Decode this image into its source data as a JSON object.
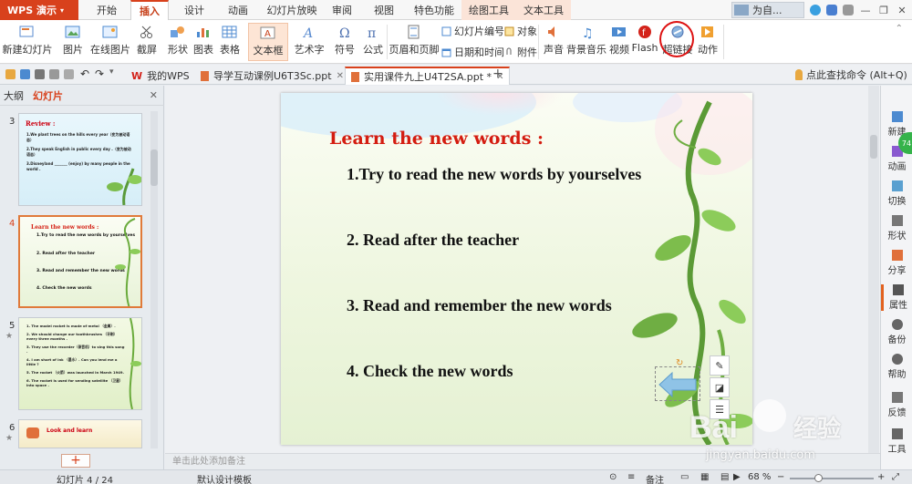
{
  "app": {
    "name": "WPS 演示"
  },
  "menu_tabs": [
    {
      "label": "开始"
    },
    {
      "label": "插入"
    },
    {
      "label": "设计"
    },
    {
      "label": "动画"
    },
    {
      "label": "幻灯片放映"
    },
    {
      "label": "审阅"
    },
    {
      "label": "视图"
    },
    {
      "label": "特色功能"
    },
    {
      "label": "绘图工具"
    },
    {
      "label": "文本工具"
    }
  ],
  "active_tab": "插入",
  "user": {
    "name": "为自..."
  },
  "ribbon": {
    "new_slide": "新建幻灯片",
    "picture": "图片",
    "online_picture": "在线图片",
    "screenshot": "截屏",
    "shape": "形状",
    "chart": "图表",
    "table": "表格",
    "textbox": "文本框",
    "art_text": "艺术字",
    "symbol": "符号",
    "formula": "公式",
    "header_footer": "页眉和页脚",
    "slide_number": "幻灯片编号",
    "object": "对象",
    "date_time": "日期和时间",
    "attachment": "附件",
    "sound": "声音",
    "bg_music": "背景音乐",
    "video": "视频",
    "flash": "Flash",
    "hyperlink": "超链接",
    "action": "动作"
  },
  "doc_tabs": [
    {
      "label": "我的WPS",
      "active": false
    },
    {
      "label": "导学互动课例U6T3Sc.ppt",
      "active": false
    },
    {
      "label": "实用课件九上U4T2SA.ppt *",
      "active": true
    }
  ],
  "find_command": "点此查找命令 (Alt+Q)",
  "left_panel": {
    "tab_outline": "大纲",
    "tab_slides": "幻灯片",
    "slides": [
      {
        "number": "3",
        "title": "Review :",
        "lines": [
          "1.We plant trees on the hills every year（变为被动语态）",
          "2.They speak English in public every day .（变为被动语态）",
          "3.Disneyland _______ (enjoy) by many people in the world ."
        ]
      },
      {
        "number": "4",
        "title": "Learn the new words :",
        "lines": [
          "1.Try to read the new words by yourselves",
          "2. Read after the teacher",
          "3. Read and remember the new words",
          "4. Check the new words"
        ]
      },
      {
        "number": "5",
        "lines": [
          "1. The model rocket is made of metal （金属）.",
          "2. We should change our toothbrushes （牙刷） every three months .",
          "3. They use the recorder（录音机）to sing this song .",
          "4. I am short of ink （墨水）. Can you lend me a little ?",
          "5. The rocket （火箭）was launched in March 1949.",
          "6. The rocket is used for sending satellite （卫星） into space ."
        ]
      },
      {
        "number": "6",
        "title": "Look and learn"
      }
    ]
  },
  "slide": {
    "title": "Learn the new words :",
    "items": [
      "1.Try to read the new words by yourselves",
      "2. Read after the teacher",
      "3. Read and remember the new words",
      "4. Check the new words"
    ]
  },
  "notes_placeholder": "单击此处添加备注",
  "right_pane": [
    {
      "label": "新建"
    },
    {
      "label": "动画"
    },
    {
      "label": "切换"
    },
    {
      "label": "形状"
    },
    {
      "label": "分享"
    },
    {
      "label": "属性"
    },
    {
      "label": "备份"
    },
    {
      "label": "帮助"
    },
    {
      "label": "反馈"
    },
    {
      "label": "工具"
    }
  ],
  "status": {
    "slide_counter": "幻灯片 4 / 24",
    "template": "默认设计模板",
    "notes": "备注",
    "zoom": "68 %"
  },
  "watermark": {
    "brand": "Bai",
    "brand2": "经验",
    "url": "jingyan.baidu.com"
  },
  "colors": {
    "accent": "#d8411c",
    "slide_title": "#d41c10",
    "highlight_circle": "#dd1111"
  }
}
